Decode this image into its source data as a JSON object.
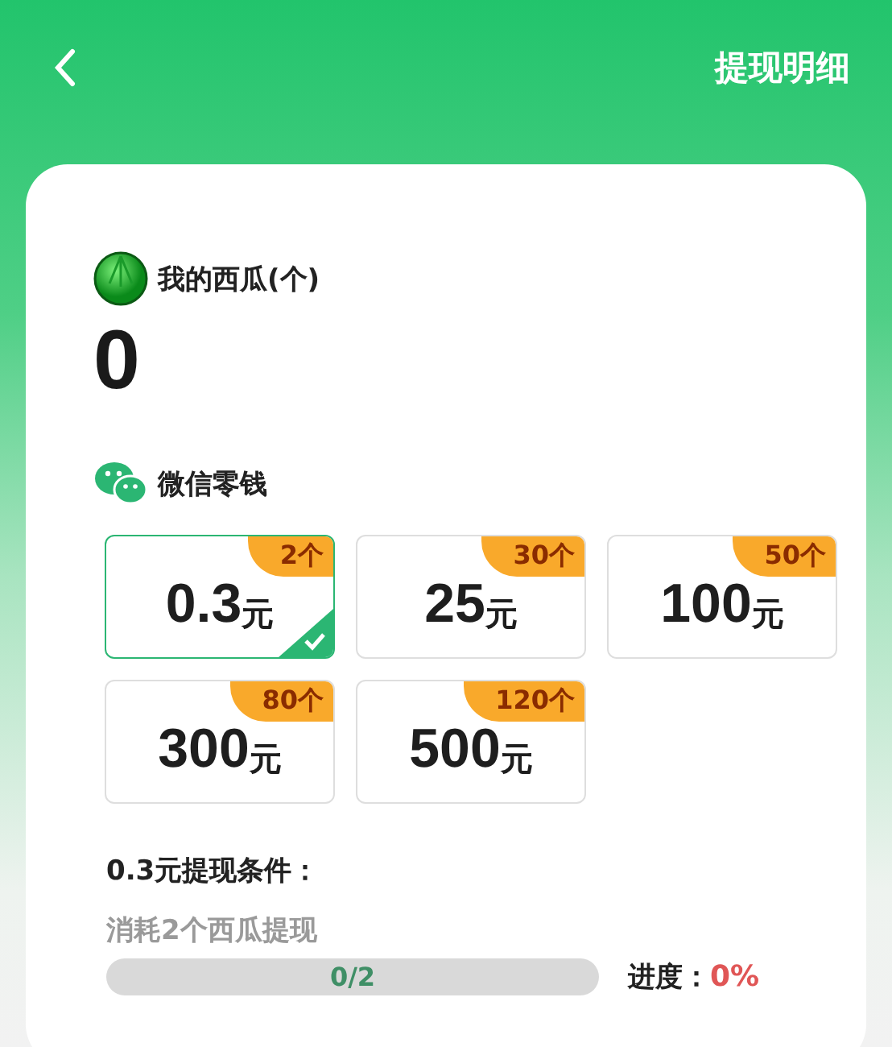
{
  "header": {
    "title": "提现明细"
  },
  "balance": {
    "label": "我的西瓜(个)",
    "value": "0"
  },
  "wallet": {
    "label": "微信零钱"
  },
  "options": [
    {
      "amount": "0.3",
      "unit": "元",
      "cost": "2个",
      "selected": true
    },
    {
      "amount": "25",
      "unit": "元",
      "cost": "30个",
      "selected": false
    },
    {
      "amount": "100",
      "unit": "元",
      "cost": "50个",
      "selected": false
    },
    {
      "amount": "300",
      "unit": "元",
      "cost": "80个",
      "selected": false
    },
    {
      "amount": "500",
      "unit": "元",
      "cost": "120个",
      "selected": false
    }
  ],
  "condition": {
    "title": "0.3元提现条件：",
    "description": "消耗2个西瓜提现",
    "progress_text": "0/2",
    "level": 0,
    "progress_label": "进度：",
    "progress_value": "0%"
  }
}
